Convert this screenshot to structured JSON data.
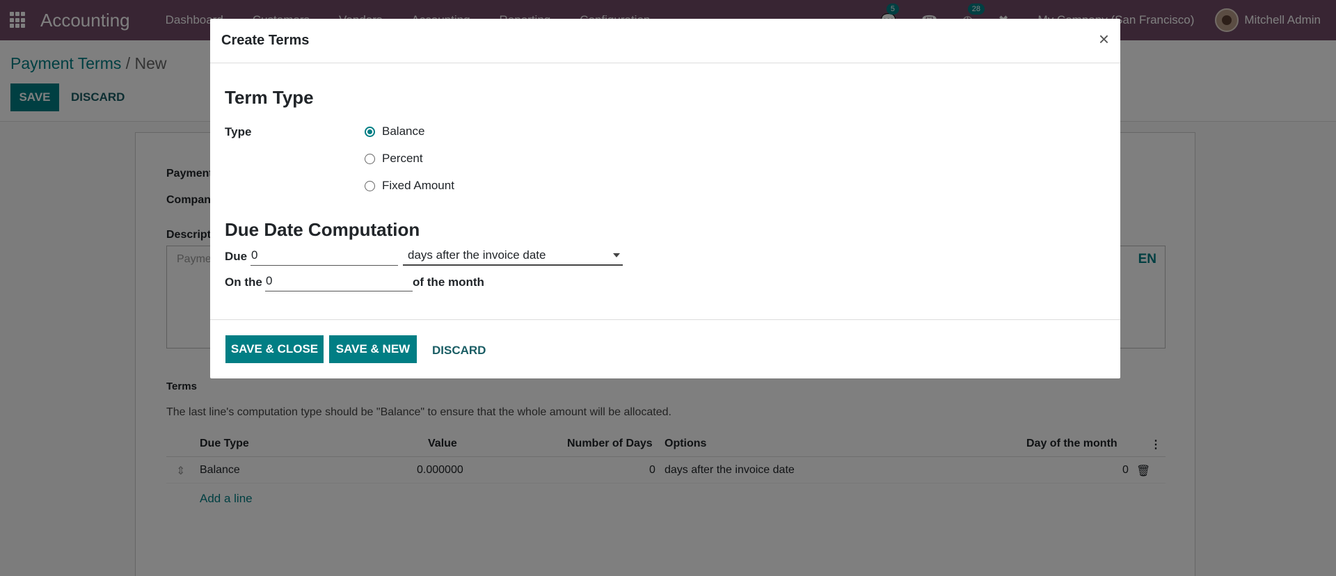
{
  "navbar": {
    "app_title": "Accounting",
    "menu": [
      "Dashboard",
      "Customers",
      "Vendors",
      "Accounting",
      "Reporting",
      "Configuration"
    ],
    "messages_count": "5",
    "activities_count": "28",
    "company": "My Company (San Francisco)",
    "user": "Mitchell Admin"
  },
  "control_panel": {
    "breadcrumb_parent": "Payment Terms",
    "breadcrumb_current": "/ New",
    "save_label": "SAVE",
    "discard_label": "DISCARD"
  },
  "form": {
    "payment_terms_label": "Payment",
    "company_label": "Compan",
    "description_label": "Descript",
    "description_placeholder": "Payme",
    "lang": "EN",
    "terms_label": "Terms",
    "terms_help": "The last line's computation type should be \"Balance\" to ensure that the whole amount will be allocated.",
    "columns": {
      "due_type": "Due Type",
      "value": "Value",
      "number_of_days": "Number of Days",
      "options": "Options",
      "day_of_month": "Day of the month"
    },
    "rows": [
      {
        "due_type": "Balance",
        "value": "0.000000",
        "number_of_days": "0",
        "options": "days after the invoice date",
        "day_of_month": "0"
      }
    ],
    "add_line": "Add a line"
  },
  "modal": {
    "title": "Create Terms",
    "close": "×",
    "term_type_title": "Term Type",
    "type_label": "Type",
    "options": [
      "Balance",
      "Percent",
      "Fixed Amount"
    ],
    "selected_option": "Balance",
    "due_date_title": "Due Date Computation",
    "due_label": "Due",
    "due_value": "0",
    "due_option": "days after the invoice date",
    "on_the_label": "On the",
    "on_the_value": "0",
    "of_month_label": "of the month",
    "save_close": "SAVE & CLOSE",
    "save_new": "SAVE & NEW",
    "discard": "DISCARD"
  },
  "colors": {
    "navbar": "#714b67",
    "primary": "#017e84"
  }
}
